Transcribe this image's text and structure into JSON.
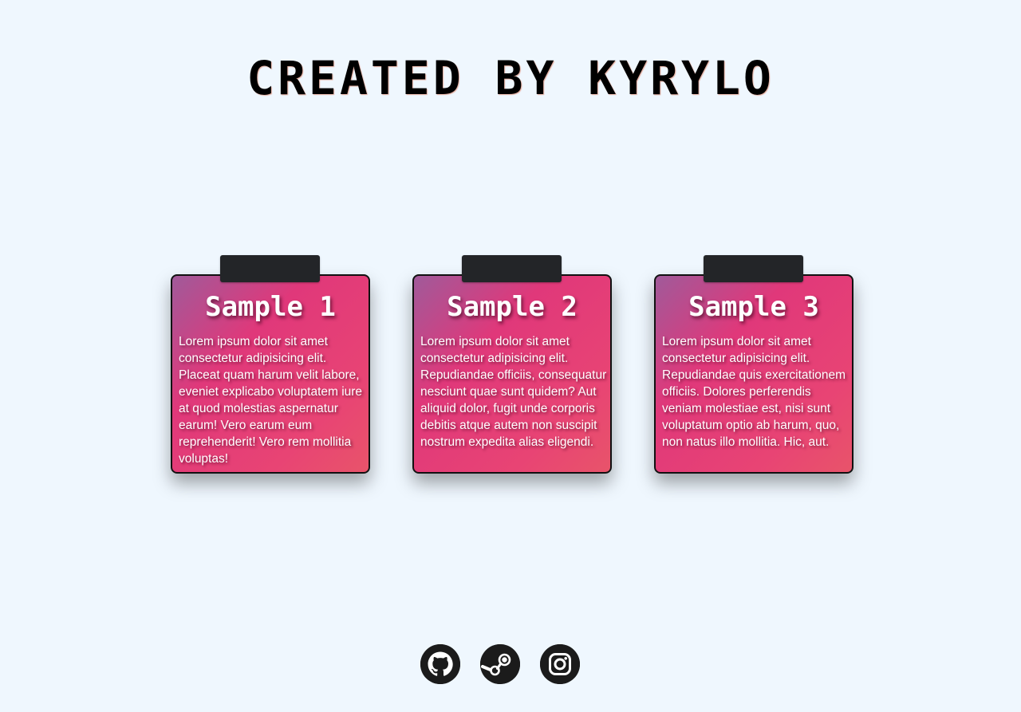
{
  "header": {
    "title": "CREATED BY KYRYLO"
  },
  "cards": [
    {
      "title": "Sample 1",
      "text": "Lorem ipsum dolor sit amet consectetur adipisicing elit. Placeat quam harum velit labore, eveniet explicabo voluptatem iure at quod molestias aspernatur earum! Vero earum eum reprehenderit! Vero rem mollitia voluptas!"
    },
    {
      "title": "Sample 2",
      "text": "Lorem ipsum dolor sit amet consectetur adipisicing elit. Repudiandae officiis, consequatur nesciunt quae sunt quidem? Aut aliquid dolor, fugit unde corporis debitis atque autem non suscipit nostrum expedita alias eligendi."
    },
    {
      "title": "Sample 3",
      "text": "Lorem ipsum dolor sit amet consectetur adipisicing elit. Repudiandae quis exercitationem officiis. Dolores perferendis veniam molestiae est, nisi sunt voluptatum optio ab harum, quo, non natus illo mollitia. Hic, aut."
    }
  ],
  "socials": [
    {
      "icon": "github-icon"
    },
    {
      "icon": "steam-icon"
    },
    {
      "icon": "instagram-icon"
    }
  ],
  "colors": {
    "background": "#eff7fe",
    "card_gradient_start": "#a05a9a",
    "card_gradient_end": "#e8546a",
    "tape": "#232528",
    "icon": "#1b1b1b"
  }
}
